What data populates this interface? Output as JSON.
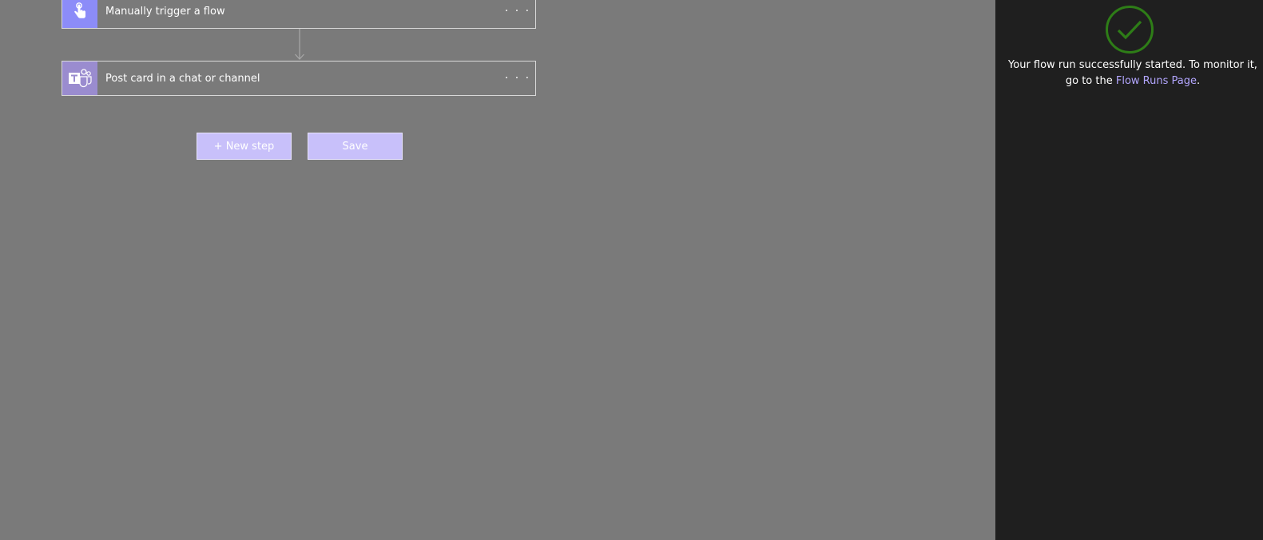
{
  "flow": {
    "steps": [
      {
        "title": "Manually trigger a flow",
        "icon": "touch-hand-icon",
        "more_label": "· · ·"
      },
      {
        "title": "Post card in a chat or channel",
        "icon": "teams-icon",
        "more_label": "· · ·"
      }
    ],
    "new_step_label": "+ New step",
    "save_label": "Save"
  },
  "side_panel": {
    "status_icon": "success-check-icon",
    "message_line1": "Your flow run successfully started. To monitor it,",
    "message_prefix": "go to the ",
    "link_label": "Flow Runs Page",
    "message_suffix": "."
  },
  "colors": {
    "canvas_bg": "#7a7a7a",
    "panel_bg": "#1f1f1f",
    "trigger_icon_bg": "#8c8cf8",
    "teams_icon_bg": "#9a8ccf",
    "button_bg": "#c8c0fa",
    "success_green": "#2e7d17",
    "link_color": "#b3a6ff"
  }
}
